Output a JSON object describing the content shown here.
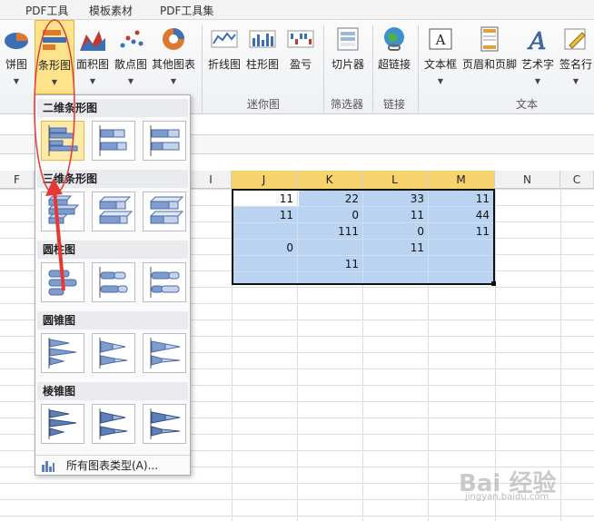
{
  "tabs": [
    "PDF工具",
    "模板素材",
    "PDF工具集"
  ],
  "ribbon": {
    "pie": "饼图",
    "bar": "条形图",
    "area": "面积图",
    "scatter": "散点图",
    "other": "其他图表",
    "line": "折线图",
    "column": "柱形图",
    "winloss": "盈亏",
    "slicer": "切片器",
    "hyperlink": "超链接",
    "textbox": "文本框",
    "header_footer": "页眉和页脚",
    "wordart": "艺术字",
    "signature": "签名行",
    "groups": {
      "sparklines": "迷你图",
      "filter": "筛选器",
      "links": "链接",
      "text": "文本"
    }
  },
  "columns": {
    "f": "F",
    "i": "I",
    "j": "J",
    "k": "K",
    "l": "L",
    "m": "M",
    "n": "N",
    "o": "C"
  },
  "cells": {
    "r1": [
      "11",
      "22",
      "33",
      "11"
    ],
    "r2": [
      "11",
      "0",
      "11",
      "44"
    ],
    "r3": [
      "",
      "111",
      "0",
      "11"
    ],
    "r4": [
      "0",
      "",
      "11",
      ""
    ],
    "r5": [
      "",
      "11",
      "",
      ""
    ]
  },
  "dropdown": {
    "section_2d": "二维条形图",
    "section_3d": "三维条形图",
    "section_cylinder": "圆柱图",
    "section_cone": "圆锥图",
    "section_pyramid": "棱锥图",
    "all_types": "所有图表类型(A)..."
  },
  "watermark": "Bai 经验",
  "watermark_sub": "jingyan.baidu.com",
  "colors": {
    "accent_selected": "#f7d36e",
    "selection_fill": "#b9d3f0",
    "annotation": "#e53935"
  }
}
